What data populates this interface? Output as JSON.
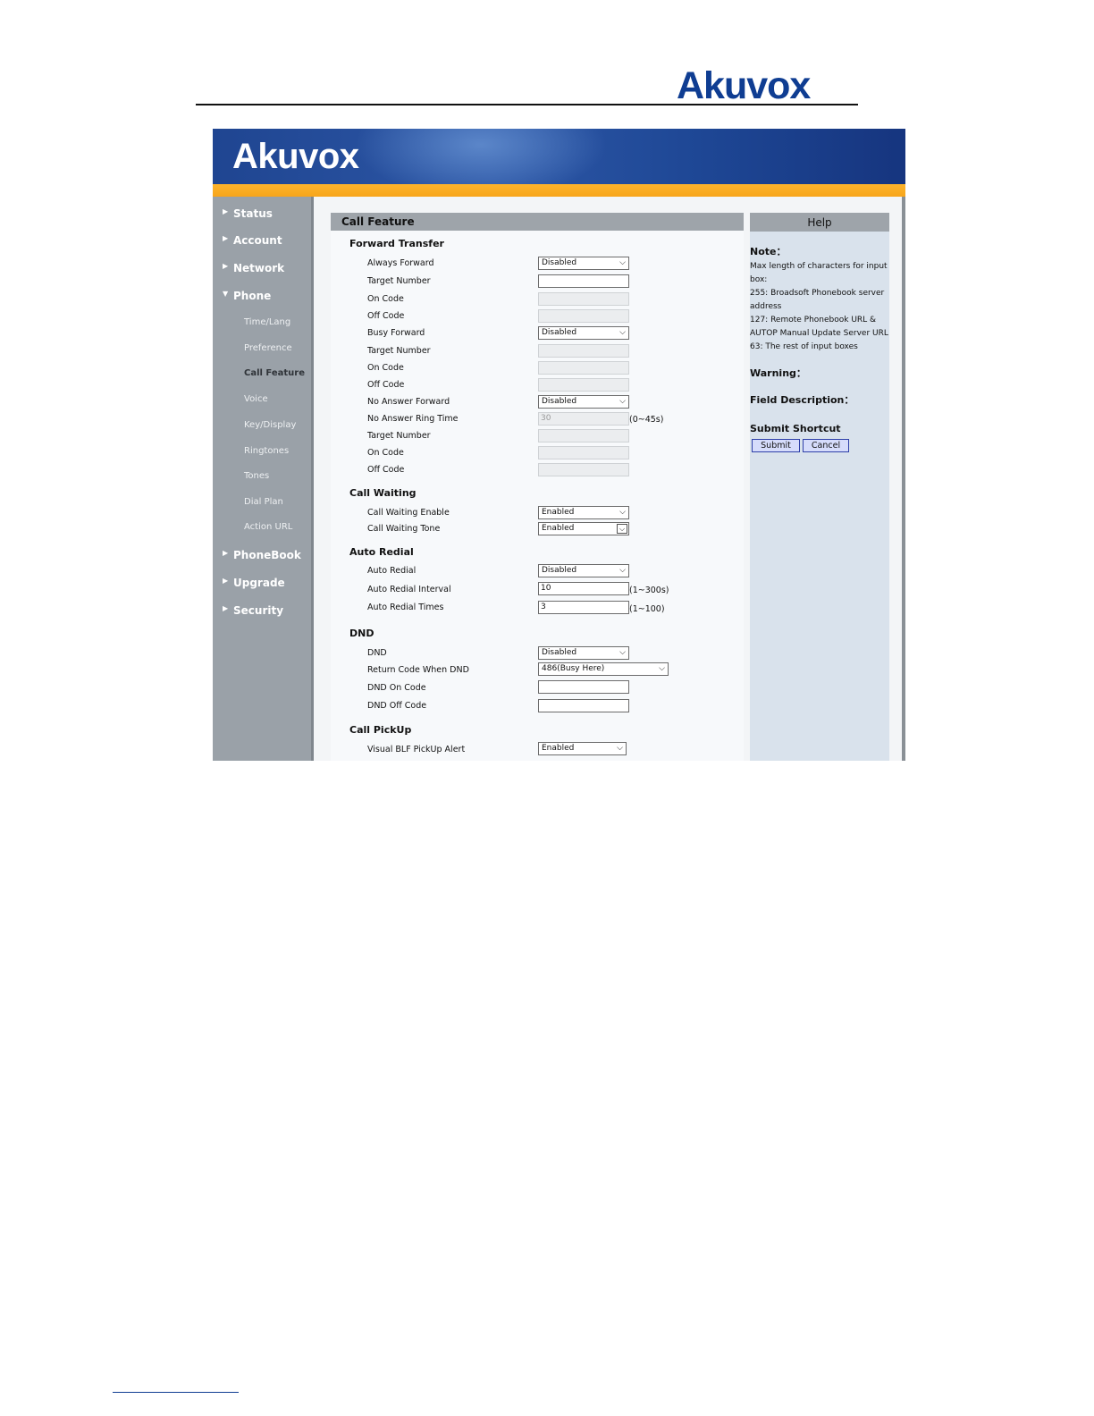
{
  "document": {
    "logo_text": "Akuvox"
  },
  "banner": {
    "logo_text": "Akuvox"
  },
  "sidebar": {
    "main_items": [
      "Status",
      "Account",
      "Network",
      "Phone",
      "PhoneBook",
      "Upgrade",
      "Security"
    ],
    "phone_sub_items": [
      "Time/Lang",
      "Preference",
      "Call Feature",
      "Voice",
      "Key/Display",
      "Ringtones",
      "Tones",
      "Dial Plan",
      "Action URL"
    ],
    "active_sub_item": "Call Feature"
  },
  "content": {
    "title": "Call Feature",
    "forward_transfer": {
      "title": "Forward Transfer",
      "always_forward_label": "Always Forward",
      "always_forward_value": "Disabled",
      "always_target_label": "Target Number",
      "always_target_value": "",
      "always_on_code_label": "On Code",
      "always_off_code_label": "Off Code",
      "busy_forward_label": "Busy Forward",
      "busy_forward_value": "Disabled",
      "busy_target_label": "Target Number",
      "busy_on_code_label": "On Code",
      "busy_off_code_label": "Off Code",
      "no_answer_forward_label": "No Answer Forward",
      "no_answer_forward_value": "Disabled",
      "no_answer_ring_time_label": "No Answer Ring Time",
      "no_answer_ring_time_value": "30",
      "no_answer_ring_time_hint": "(0~45s)",
      "no_answer_target_label": "Target Number",
      "no_answer_on_code_label": "On Code",
      "no_answer_off_code_label": "Off Code"
    },
    "call_waiting": {
      "title": "Call Waiting",
      "enable_label": "Call Waiting Enable",
      "enable_value": "Enabled",
      "tone_label": "Call Waiting Tone",
      "tone_value": "Enabled"
    },
    "auto_redial": {
      "title": "Auto Redial",
      "auto_redial_label": "Auto Redial",
      "auto_redial_value": "Disabled",
      "interval_label": "Auto Redial Interval",
      "interval_value": "10",
      "interval_hint": "(1~300s)",
      "times_label": "Auto Redial Times",
      "times_value": "3",
      "times_hint": "(1~100)"
    },
    "dnd": {
      "title": "DND",
      "dnd_label": "DND",
      "dnd_value": "Disabled",
      "return_code_label": "Return Code When DND",
      "return_code_value": "486(Busy Here)",
      "on_code_label": "DND On Code",
      "on_code_value": "",
      "off_code_label": "DND Off Code",
      "off_code_value": ""
    },
    "call_pickup": {
      "title": "Call PickUp",
      "visual_blf_label": "Visual BLF PickUp Alert",
      "visual_blf_value": "Enabled"
    }
  },
  "help": {
    "title": "Help",
    "note_title": "Note：",
    "note_lines": [
      "Max length of characters for input",
      "box:",
      "255: Broadsoft Phonebook server",
      "address",
      "127: Remote Phonebook URL &",
      "AUTOP Manual Update Server URL",
      "63: The rest of input boxes"
    ],
    "warning_title": "Warning：",
    "field_description_title": "Field Description：",
    "submit_shortcut_title": "Submit Shortcut",
    "submit_label": "Submit",
    "cancel_label": "Cancel"
  },
  "icons": {
    "collapsed": "triangle-right",
    "expanded": "triangle-down",
    "dropdown": "chevron-down"
  },
  "colors": {
    "brand_blue": "#0f3d92",
    "banner_stripe": "#f7a51b",
    "sidebar_bg": "#9aa1a8",
    "header_gray": "#9ea4aa",
    "help_bg": "#d9e2ec"
  }
}
